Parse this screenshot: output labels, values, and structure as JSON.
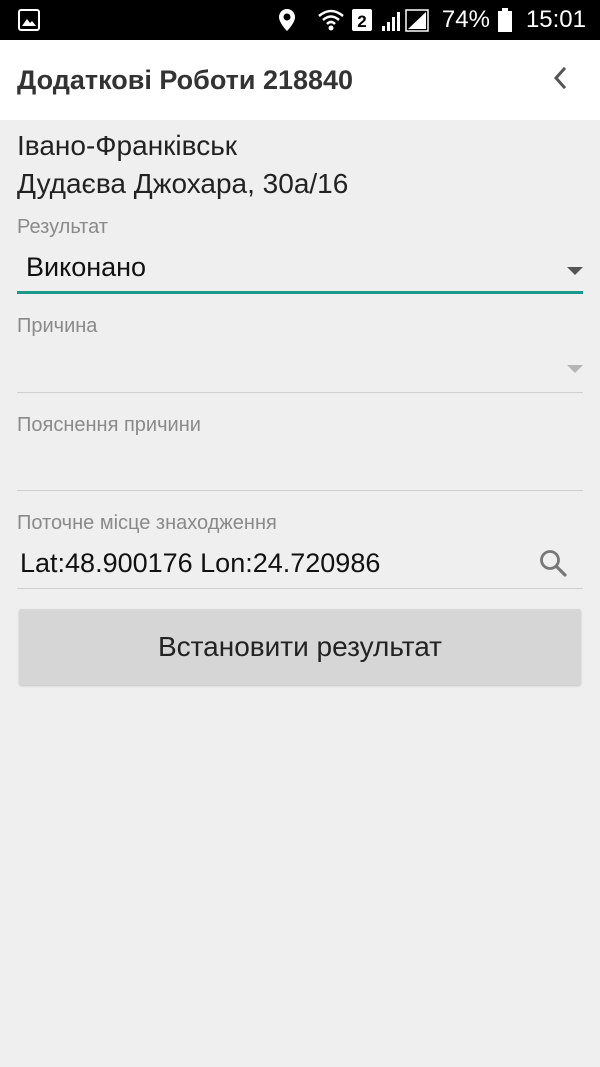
{
  "status_bar": {
    "battery_percent": "74%",
    "time": "15:01",
    "sim_badge": "2",
    "icons": [
      "image-icon",
      "location-icon",
      "wifi-icon",
      "sim-icon",
      "signal-icon",
      "battery-icon"
    ]
  },
  "app_bar": {
    "title": "Додаткові Роботи 218840",
    "back_icon": "chevron-left-icon"
  },
  "address": {
    "city": "Івано-Франківськ",
    "street": "Дудаєва Джохара, 30а/16"
  },
  "form": {
    "result": {
      "label": "Результат",
      "value": "Виконано"
    },
    "reason": {
      "label": "Причина",
      "value": ""
    },
    "explanation": {
      "label": "Пояснення причини",
      "value": ""
    },
    "location": {
      "label": "Поточне місце знаходження",
      "value": "Lat:48.900176 Lon:24.720986"
    }
  },
  "submit_button": {
    "label": "Встановити результат"
  },
  "colors": {
    "accent": "#1a9a8a",
    "background": "#efefef",
    "button": "#d6d6d6"
  }
}
